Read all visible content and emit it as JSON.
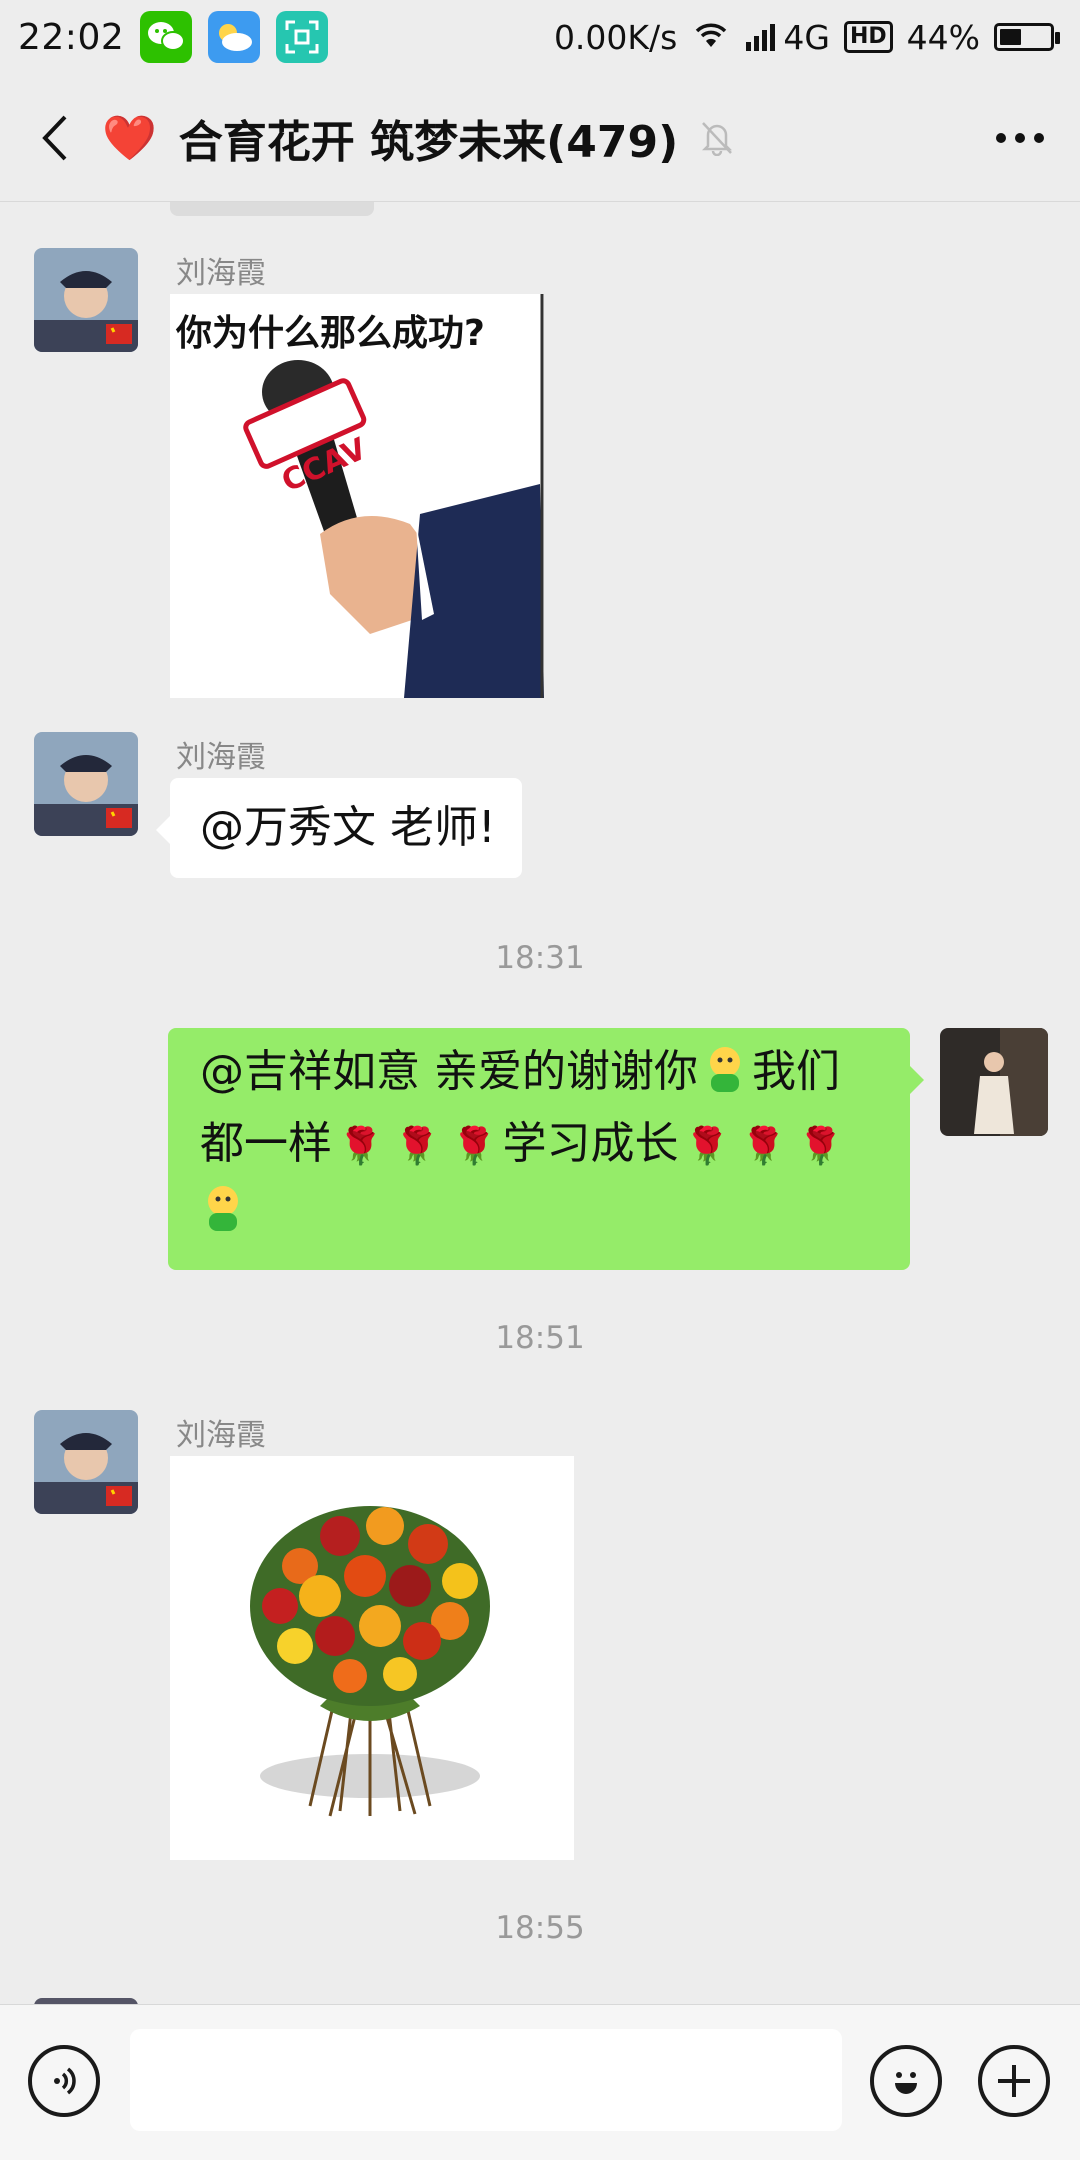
{
  "status_bar": {
    "time": "22:02",
    "network_speed": "0.00K/s",
    "network_type": "4G",
    "hd_label": "HD",
    "battery_percent": "44%",
    "battery_level": 0.44,
    "apps": [
      "wechat-icon",
      "weather-icon",
      "scan-icon"
    ]
  },
  "header": {
    "emoji": "❤️",
    "title": "合育花开 筑梦未来(479)",
    "muted": true
  },
  "messages": {
    "m1": {
      "sender": "刘海霞",
      "image_caption": "你为什么那么成功?",
      "mic_label": "CCAV"
    },
    "m2": {
      "sender": "刘海霞",
      "text": "@万秀文  老师!"
    },
    "t1": "18:31",
    "m3": {
      "line1": "@吉祥如意  亲爱的谢谢你",
      "line1_end": "我们",
      "line2_start": "都一样",
      "line2_mid": "学习成长",
      "rose": "🌹"
    },
    "t2": "18:51",
    "m4": {
      "sender": "刘海霞",
      "image": "flower-bouquet"
    },
    "t3": "18:55"
  },
  "colors": {
    "background": "#ededed",
    "self_bubble": "#95ec69",
    "other_bubble": "#ffffff",
    "timestamp": "#999999"
  }
}
